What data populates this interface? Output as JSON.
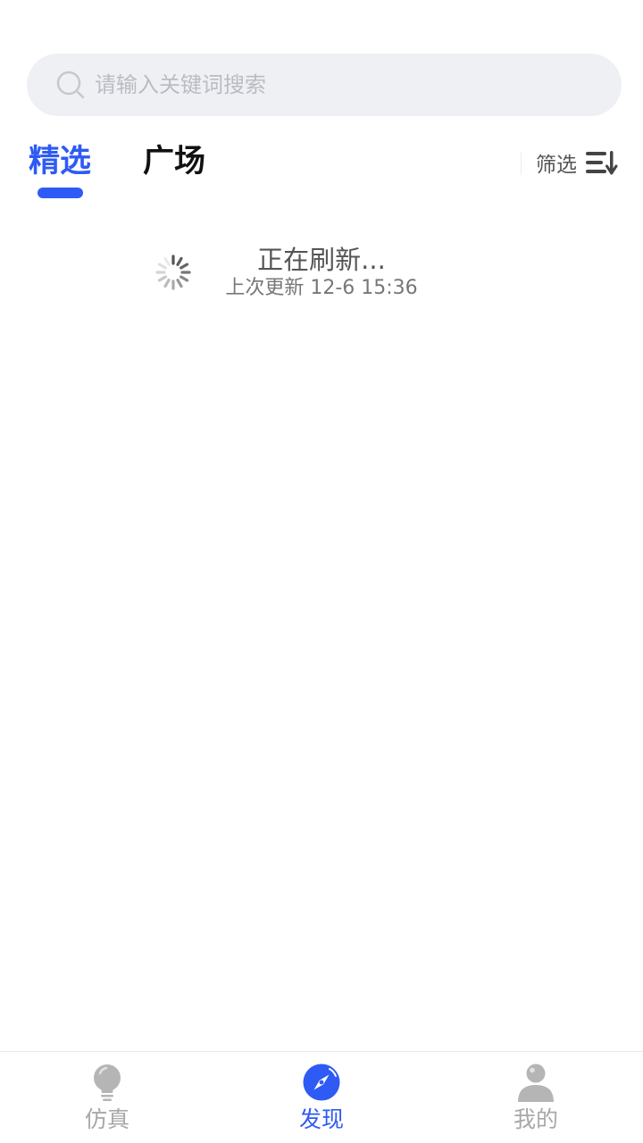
{
  "search": {
    "placeholder": "请输入关键词搜索",
    "value": ""
  },
  "tabs": [
    {
      "label": "精选",
      "active": true
    },
    {
      "label": "广场",
      "active": false
    }
  ],
  "filter": {
    "label": "筛选",
    "icon": "sort-list-icon"
  },
  "refresh": {
    "status": "正在刷新...",
    "last_updated": "上次更新 12-6 15:36"
  },
  "bottom_nav": {
    "items": [
      {
        "label": "仿真",
        "icon": "lightbulb-icon",
        "active": false
      },
      {
        "label": "发现",
        "icon": "compass-icon",
        "active": true
      },
      {
        "label": "我的",
        "icon": "person-icon",
        "active": false
      }
    ]
  },
  "colors": {
    "accent": "#2e5bf5",
    "inactive": "#a8a8a8",
    "search_bg": "#eef0f4"
  }
}
